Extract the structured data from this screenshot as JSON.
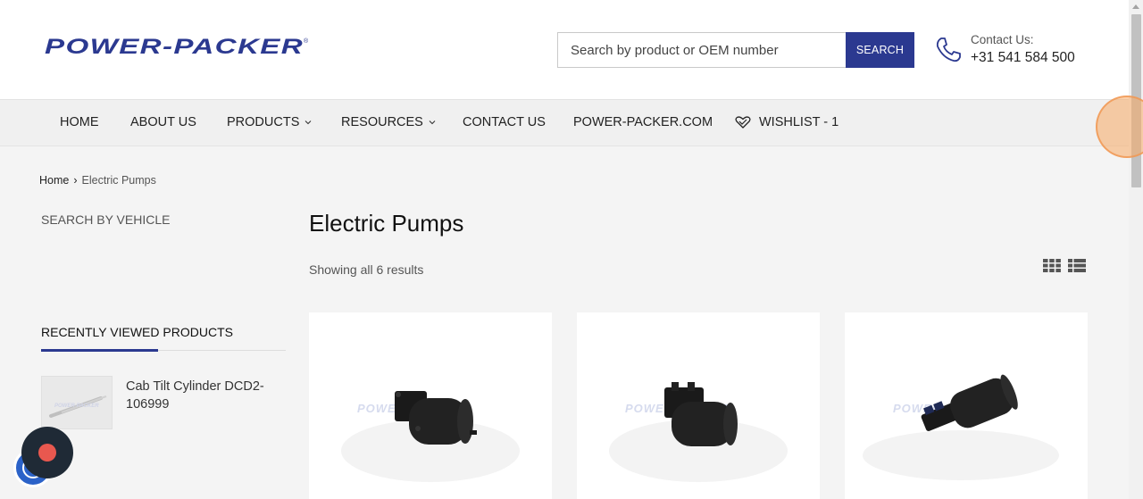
{
  "header": {
    "logo_text": "POWER-PACKER",
    "search_placeholder": "Search by product or OEM number",
    "search_button": "SEARCH",
    "contact_label": "Contact Us:",
    "contact_phone": "+31 541 584 500"
  },
  "nav": {
    "items": [
      {
        "label": "HOME"
      },
      {
        "label": "ABOUT US"
      },
      {
        "label": "PRODUCTS"
      },
      {
        "label": "RESOURCES"
      },
      {
        "label": "CONTACT US"
      },
      {
        "label": "POWER-PACKER.COM"
      },
      {
        "label": "WISHLIST - 1"
      }
    ]
  },
  "breadcrumb": {
    "home": "Home",
    "separator": "›",
    "current": "Electric Pumps"
  },
  "sidebar": {
    "search_by_vehicle": "SEARCH BY VEHICLE",
    "recently_viewed_heading": "RECENTLY VIEWED PRODUCTS",
    "recently_viewed": [
      {
        "title": "Cab Tilt Cylinder DCD2-106999"
      }
    ]
  },
  "main": {
    "title": "Electric Pumps",
    "result_count": "Showing all 6 results",
    "products": [
      {
        "image_icon": "electric-pump-image",
        "watermark": "POWER-PACKER"
      },
      {
        "image_icon": "electric-pump-image",
        "watermark": "POWER-PACKER"
      },
      {
        "image_icon": "electric-pump-image",
        "watermark": "POWER-PACKER"
      }
    ]
  },
  "colors": {
    "brand_blue": "#2b3990",
    "background": "#f4f4f4"
  }
}
